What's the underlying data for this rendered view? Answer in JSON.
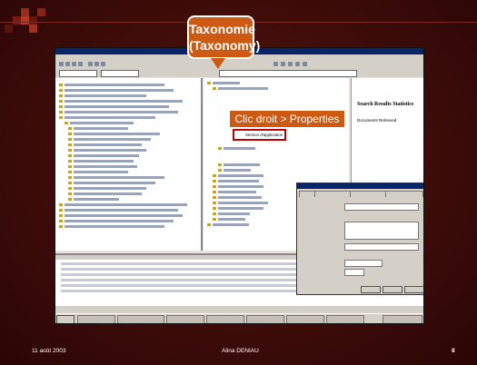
{
  "slide": {
    "callout_title": "Taxonomie",
    "callout_subtitle": "(Taxonomy)",
    "callout_action": "Clic droit > Properties",
    "date": "11 août 2003",
    "author": "Alina DENIAU",
    "page_number": "8"
  },
  "app": {
    "selected_node": "Service d'application",
    "search_results_title": "Search Results Statistics",
    "documents_retrieved": "Documents Retrieved"
  },
  "colors": {
    "callout": "#cc5a12",
    "highlight": "#c00000",
    "background": "#3e0c09"
  }
}
